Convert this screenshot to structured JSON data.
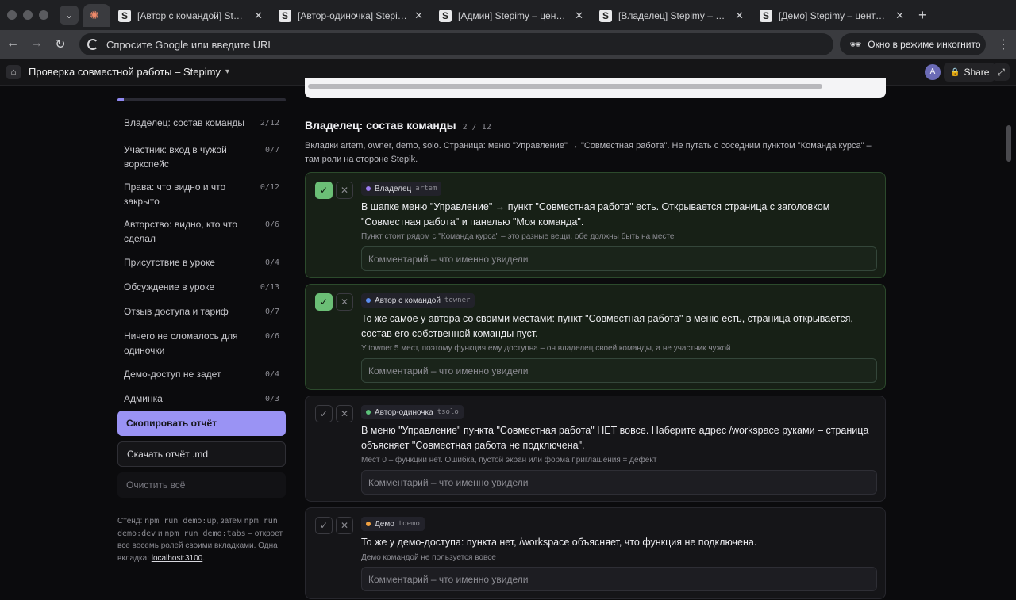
{
  "browser": {
    "tabs": [
      {
        "title": "[Автор с командой] Stepimy –",
        "favicon": "S"
      },
      {
        "title": "[Автор-одиночка] Stepimy –",
        "favicon": "S"
      },
      {
        "title": "[Админ] Stepimy – центр упр",
        "favicon": "S"
      },
      {
        "title": "[Владелец] Stepimy – центр",
        "favicon": "S"
      },
      {
        "title": "[Демо] Stepimy – центр упр",
        "favicon": "S"
      }
    ],
    "omnibox_placeholder": "Спросите Google или введите URL",
    "incognito_label": "Окно в режиме инкогнито"
  },
  "app": {
    "title": "Проверка совместной работы – Stepimy",
    "avatar_initial": "A",
    "share_label": "Share"
  },
  "sidebar": {
    "progress_fraction": 0.04,
    "items": [
      {
        "label": "Владелец: состав команды",
        "count": "2/12"
      },
      {
        "label": "Участник: вход в чужой воркспейс",
        "count": "0/7"
      },
      {
        "label": "Права: что видно и что закрыто",
        "count": "0/12"
      },
      {
        "label": "Авторство: видно, кто что сделал",
        "count": "0/6"
      },
      {
        "label": "Присутствие в уроке",
        "count": "0/4"
      },
      {
        "label": "Обсуждение в уроке",
        "count": "0/13"
      },
      {
        "label": "Отзыв доступа и тариф",
        "count": "0/7"
      },
      {
        "label": "Ничего не сломалось для одиночки",
        "count": "0/6"
      },
      {
        "label": "Демо-доступ не задет",
        "count": "0/4"
      },
      {
        "label": "Админка",
        "count": "0/3"
      }
    ],
    "copy_report": "Скопировать отчёт",
    "download_report": "Скачать отчёт .md",
    "clear_all": "Очистить всё",
    "hint_prefix": "Стенд: ",
    "hint_cmd1": "npm run demo:up",
    "hint_mid1": ", затем ",
    "hint_cmd2": "npm run demo:dev",
    "hint_mid2": " и ",
    "hint_cmd3": "npm run demo:tabs",
    "hint_mid3": " – откроет все восемь ролей своими вкладками. Одна вкладка: ",
    "hint_link": "localhost:3100",
    "hint_end": "."
  },
  "section": {
    "title": "Владелец: состав команды",
    "count": "2 / 12",
    "description": "Вкладки artem, owner, demo, solo. Страница: меню \"Управление\" → \"Совместная работа\". Не путать с соседним пунктом \"Команда курса\" – там роли на стороне Stepik."
  },
  "cards": [
    {
      "checked": true,
      "role": "Владелец",
      "login": "artem",
      "dot_color": "#9b7cf0",
      "text": "В шапке меню \"Управление\" → пункт \"Совместная работа\" есть. Открывается страница с заголовком \"Совместная работа\" и панелью \"Моя команда\".",
      "note": "Пункт стоит рядом с \"Команда курса\" – это разные вещи, обе должны быть на месте",
      "comment_placeholder": "Комментарий – что именно увидели"
    },
    {
      "checked": true,
      "role": "Автор с командой",
      "login": "towner",
      "dot_color": "#5b8df0",
      "text": "То же самое у автора со своими местами: пункт \"Совместная работа\" в меню есть, страница открывается, состав его собственной команды пуст.",
      "note": "У towner 5 мест, поэтому функция ему доступна – он владелец своей команды, а не участник чужой",
      "comment_placeholder": "Комментарий – что именно увидели"
    },
    {
      "checked": false,
      "role": "Автор-одиночка",
      "login": "tsolo",
      "dot_color": "#5cc27a",
      "text": "В меню \"Управление\" пункта \"Совместная работа\" НЕТ вовсе. Наберите адрес /workspace руками – страница объясняет \"Совместная работа не подключена\".",
      "note": "Мест 0 – функции нет. Ошибка, пустой экран или форма приглашения = дефект",
      "comment_placeholder": "Комментарий – что именно увидели"
    },
    {
      "checked": false,
      "role": "Демо",
      "login": "tdemo",
      "dot_color": "#f0a040",
      "text": "То же у демо-доступа: пункта нет, /workspace объясняет, что функция не подключена.",
      "note": "Демо командой не пользуется вовсе",
      "comment_placeholder": "Комментарий – что именно увидели"
    }
  ]
}
